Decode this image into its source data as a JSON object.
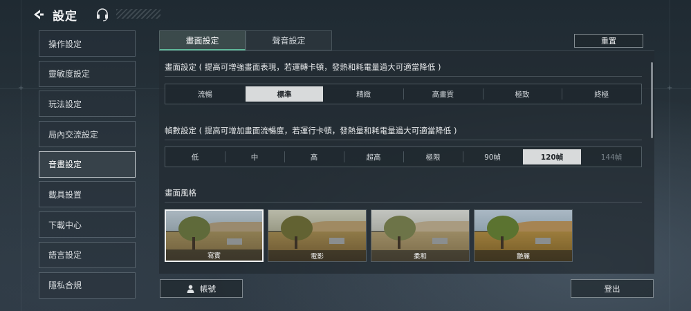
{
  "header": {
    "title": "設定",
    "back_icon": "back-arrow-icon",
    "support_icon": "headset-icon"
  },
  "sidebar": {
    "items": [
      {
        "label": "操作設定"
      },
      {
        "label": "靈敏度設定"
      },
      {
        "label": "玩法設定"
      },
      {
        "label": "局內交流設定"
      },
      {
        "label": "音畫設定",
        "active": true
      },
      {
        "label": "載具設置"
      },
      {
        "label": "下載中心"
      },
      {
        "label": "語言設定"
      },
      {
        "label": "隱私合規"
      }
    ]
  },
  "tabs": [
    {
      "label": "畫面設定",
      "active": true
    },
    {
      "label": "聲音設定"
    }
  ],
  "reset_label": "重置",
  "graphics": {
    "title": "畫面設定 ( 提高可增強畫面表現，若運轉卡頓，發熱和耗電量過大可適當降低 )",
    "options": [
      "流暢",
      "標準",
      "精緻",
      "高畫質",
      "極致",
      "終極"
    ],
    "selected": "標準"
  },
  "framerate": {
    "title": "幀數設定 ( 提高可增加畫面流暢度，若運行卡頓，發熱量和耗電量過大可適當降低 )",
    "options": [
      "低",
      "中",
      "高",
      "超高",
      "極限",
      "90幀",
      "120幀",
      "144幀"
    ],
    "selected": "120幀",
    "disabled": [
      "144幀"
    ]
  },
  "style": {
    "title": "畫面風格",
    "options": [
      {
        "label": "寫實",
        "active": true
      },
      {
        "label": "電影"
      },
      {
        "label": "柔和"
      },
      {
        "label": "艷麗"
      }
    ]
  },
  "footer": {
    "account_label": "帳號",
    "account_icon": "user-icon",
    "logout_label": "登出"
  }
}
